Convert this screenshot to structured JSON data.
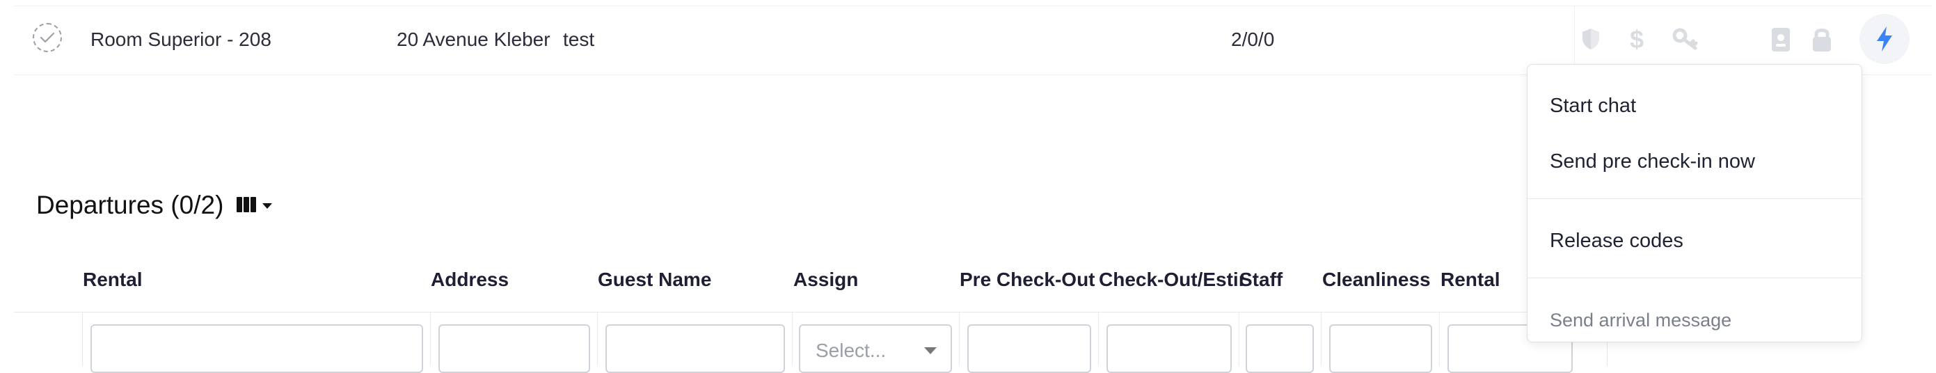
{
  "arrival_row": {
    "rental": "Room Superior - 208",
    "address": "20 Avenue Kleber",
    "guest": "test",
    "occupancy": "2/0/0"
  },
  "row_icons": [
    "shield-icon",
    "dollar-icon",
    "key-icon",
    "id-card-icon",
    "lock-icon",
    "bolt-icon"
  ],
  "departures": {
    "title": "Departures (0/2)",
    "columns": [
      "Rental",
      "Address",
      "Guest Name",
      "Assign",
      "Pre Check-Out",
      "Check-Out/Estir",
      "Staff",
      "Cleanliness",
      "Rental"
    ],
    "assign_placeholder": "Select..."
  },
  "menu": {
    "items": [
      "Start chat",
      "Send pre check-in now",
      "Release codes",
      "Send arrival message"
    ]
  },
  "colors": {
    "accent_bolt": "#3b82f6",
    "icon_muted": "#d9dce1"
  }
}
